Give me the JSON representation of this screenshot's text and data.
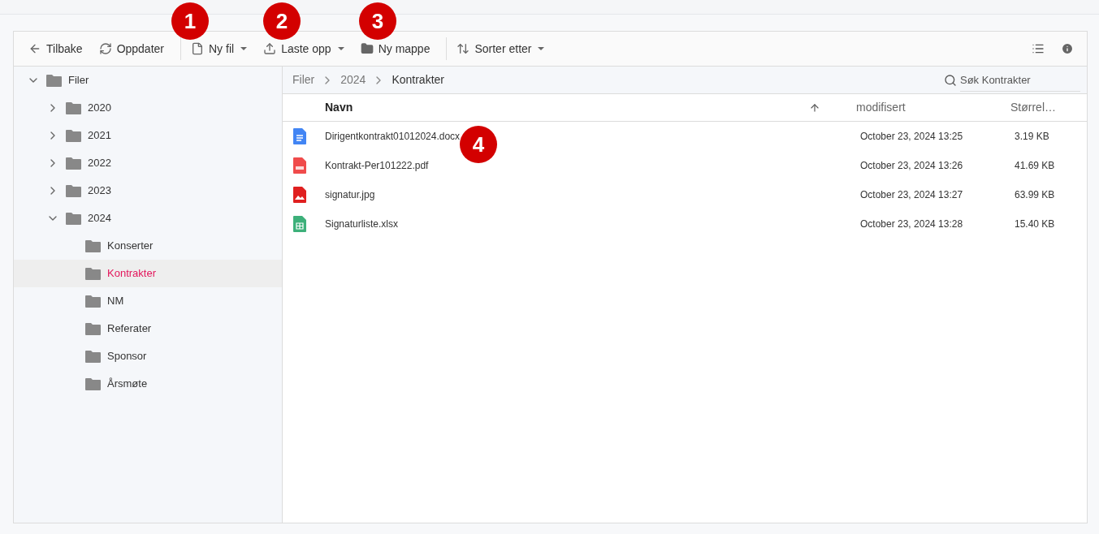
{
  "toolbar": {
    "items": [
      {
        "kind": "back",
        "label": "Tilbake",
        "dropdown": false
      },
      {
        "kind": "refresh",
        "label": "Oppdater",
        "dropdown": false
      },
      {
        "kind": "newfile",
        "label": "Ny fil",
        "dropdown": true
      },
      {
        "kind": "upload",
        "label": "Laste opp",
        "dropdown": true
      },
      {
        "kind": "folder",
        "label": "Ny mappe",
        "dropdown": false
      },
      {
        "kind": "sort",
        "label": "Sorter etter",
        "dropdown": true
      }
    ]
  },
  "tree": [
    {
      "label": "Filer",
      "expanded": true,
      "selected": false,
      "children": [
        {
          "label": "2020",
          "expanded": false,
          "selected": false
        },
        {
          "label": "2021",
          "expanded": false,
          "selected": false
        },
        {
          "label": "2022",
          "expanded": false,
          "selected": false
        },
        {
          "label": "2023",
          "expanded": false,
          "selected": false
        },
        {
          "label": "2024",
          "expanded": true,
          "selected": false,
          "children": [
            {
              "label": "Konserter",
              "selected": false
            },
            {
              "label": "Kontrakter",
              "selected": true
            },
            {
              "label": "NM",
              "selected": false
            },
            {
              "label": "Referater",
              "selected": false
            },
            {
              "label": "Sponsor",
              "selected": false
            },
            {
              "label": "Årsmøte",
              "selected": false
            }
          ]
        }
      ]
    }
  ],
  "breadcrumb": [
    "Filer",
    "2024",
    "Kontrakter"
  ],
  "search": {
    "placeholder": "Søk Kontrakter"
  },
  "table": {
    "columns": [
      "Navn",
      "modifisert",
      "Størrel…"
    ],
    "rows": [
      {
        "kind": "doc",
        "name": "Dirigentkontrakt01012024.docx",
        "modified": "October 23, 2024 13:25",
        "size": "3.19 KB"
      },
      {
        "kind": "pdf",
        "name": "Kontrakt-Per101222.pdf",
        "modified": "October 23, 2024 13:26",
        "size": "41.69 KB"
      },
      {
        "kind": "image",
        "name": "signatur.jpg",
        "modified": "October 23, 2024 13:27",
        "size": "63.99 KB"
      },
      {
        "kind": "sheet",
        "name": "Signaturliste.xlsx",
        "modified": "October 23, 2024 13:28",
        "size": "15.40 KB"
      }
    ]
  },
  "callouts": [
    "1",
    "2",
    "3",
    "4"
  ]
}
